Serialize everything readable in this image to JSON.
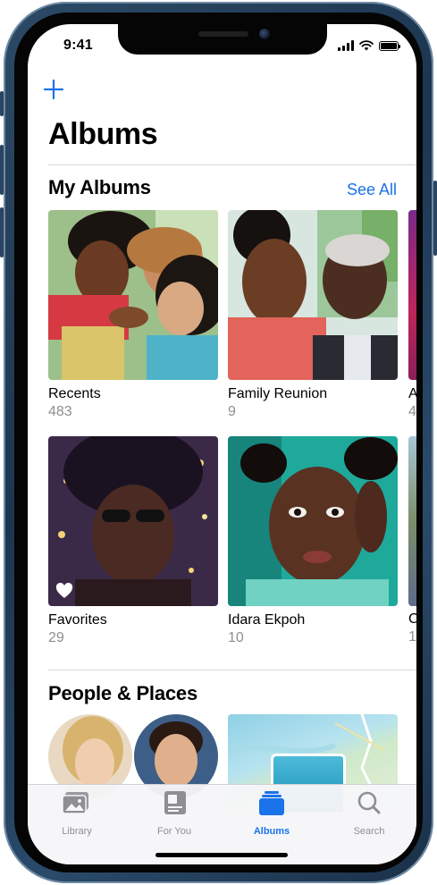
{
  "status_bar": {
    "time": "9:41"
  },
  "header": {
    "add_icon": "plus-icon",
    "title": "Albums"
  },
  "my_albums": {
    "section_title": "My Albums",
    "see_all_label": "See All",
    "albums": [
      {
        "name": "Recents",
        "count": "483"
      },
      {
        "name": "Family Reunion",
        "count": "9"
      },
      {
        "name": "Favorites",
        "count": "29"
      },
      {
        "name": "Idara Ekpoh",
        "count": "10"
      }
    ],
    "peek_row1": {
      "name": "A",
      "count": "4"
    },
    "peek_row2": {
      "name": "C",
      "count": "1"
    }
  },
  "people_places": {
    "section_title": "People & Places"
  },
  "tab_bar": {
    "tabs": [
      {
        "label": "Library",
        "icon": "photos-library-icon",
        "active": false
      },
      {
        "label": "For You",
        "icon": "for-you-icon",
        "active": false
      },
      {
        "label": "Albums",
        "icon": "albums-icon",
        "active": true
      },
      {
        "label": "Search",
        "icon": "search-icon",
        "active": false
      }
    ]
  },
  "colors": {
    "accent": "#1a73e8",
    "secondary_text": "#8e8e93",
    "device_frame": "#1c3650"
  }
}
